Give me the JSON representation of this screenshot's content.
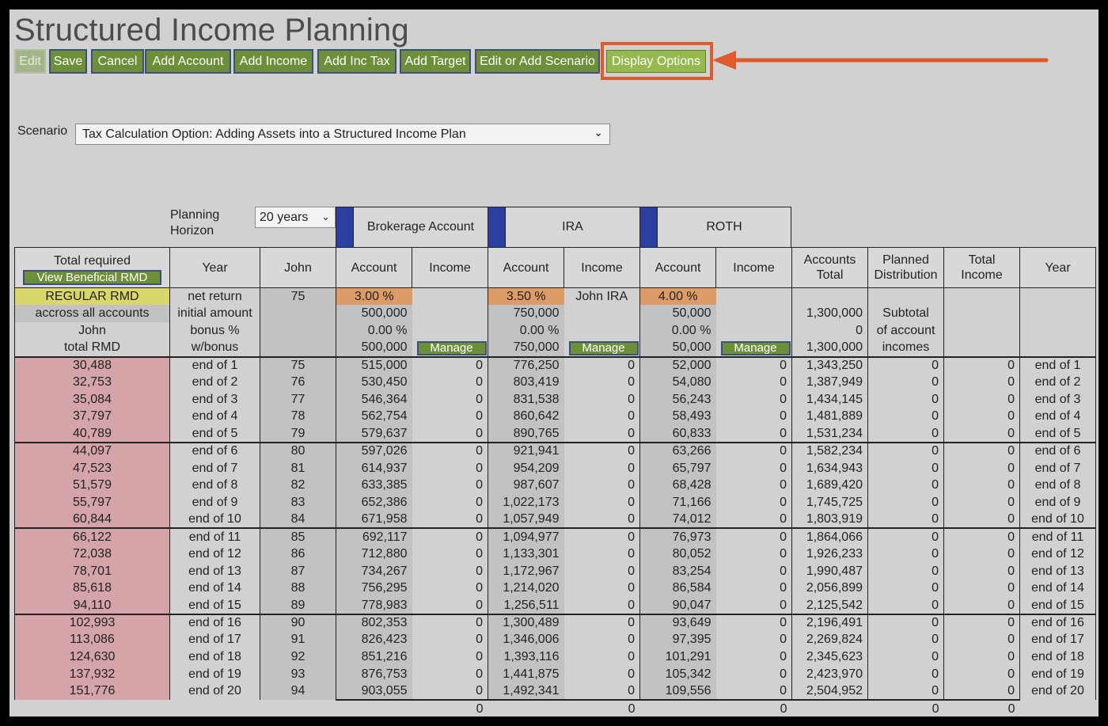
{
  "title": "Structured Income Planning",
  "toolbar": {
    "edit": "Edit",
    "save": "Save",
    "cancel": "Cancel",
    "add_account": "Add Account",
    "add_income": "Add Income",
    "add_inc_tax": "Add Inc Tax",
    "add_target": "Add Target",
    "edit_scenario": "Edit or Add Scenario",
    "display_options": "Display Options"
  },
  "colors": {
    "button": "#6d8f3a",
    "highlight": "#e05a2b",
    "rmd": "#d4a4a9",
    "swatch": "#2b3f9e"
  },
  "scenario": {
    "label": "Scenario",
    "value": "Tax Calculation Option: Adding Assets into a Structured Income Plan"
  },
  "horizon": {
    "label_line1": "Planning",
    "label_line2": "Horizon",
    "value": "20 years"
  },
  "accounts": [
    "Brokerage Account",
    "IRA",
    "ROTH"
  ],
  "headers": {
    "total_required": "Total required",
    "view_rmd": "View Beneficial RMD",
    "year": "Year",
    "john": "John",
    "account": "Account",
    "income": "Income",
    "accounts_total_1": "Accounts",
    "accounts_total_2": "Total",
    "planned_1": "Planned",
    "planned_2": "Distribution",
    "total_income_1": "Total",
    "total_income_2": "Income"
  },
  "info": {
    "regular_rmd": "REGULAR RMD",
    "across": "accross all accounts",
    "john": "John",
    "total_rmd": "total RMD",
    "labels": [
      "net return",
      "initial amount",
      "bonus %",
      "w/bonus"
    ],
    "age": "75",
    "brokerage": {
      "net_return": "3.00  %",
      "initial": "500,000",
      "bonus": "0.00  %",
      "wbonus": "500,000"
    },
    "ira": {
      "net_return": "3.50  %",
      "initial": "750,000",
      "bonus": "0.00  %",
      "wbonus": "750,000",
      "income_label": "John IRA"
    },
    "roth": {
      "net_return": "4.00  %",
      "initial": "50,000",
      "bonus": "0.00  %",
      "wbonus": "50,000"
    },
    "accounts_total": {
      "initial": "1,300,000",
      "bonus": "0",
      "wbonus": "1,300,000"
    },
    "planned": [
      "Subtotal",
      "of account",
      "incomes"
    ],
    "manage": "Manage"
  },
  "rows": [
    {
      "rmd": "30,488",
      "year": "end of 1",
      "age": "75",
      "b": "515,000",
      "i": "776,250",
      "r": "52,000",
      "tot": "1,343,250"
    },
    {
      "rmd": "32,753",
      "year": "end of 2",
      "age": "76",
      "b": "530,450",
      "i": "803,419",
      "r": "54,080",
      "tot": "1,387,949"
    },
    {
      "rmd": "35,084",
      "year": "end of 3",
      "age": "77",
      "b": "546,364",
      "i": "831,538",
      "r": "56,243",
      "tot": "1,434,145"
    },
    {
      "rmd": "37,797",
      "year": "end of 4",
      "age": "78",
      "b": "562,754",
      "i": "860,642",
      "r": "58,493",
      "tot": "1,481,889"
    },
    {
      "rmd": "40,789",
      "year": "end of 5",
      "age": "79",
      "b": "579,637",
      "i": "890,765",
      "r": "60,833",
      "tot": "1,531,234"
    },
    {
      "rmd": "44,097",
      "year": "end of 6",
      "age": "80",
      "b": "597,026",
      "i": "921,941",
      "r": "63,266",
      "tot": "1,582,234"
    },
    {
      "rmd": "47,523",
      "year": "end of 7",
      "age": "81",
      "b": "614,937",
      "i": "954,209",
      "r": "65,797",
      "tot": "1,634,943"
    },
    {
      "rmd": "51,579",
      "year": "end of 8",
      "age": "82",
      "b": "633,385",
      "i": "987,607",
      "r": "68,428",
      "tot": "1,689,420"
    },
    {
      "rmd": "55,797",
      "year": "end of 9",
      "age": "83",
      "b": "652,386",
      "i": "1,022,173",
      "r": "71,166",
      "tot": "1,745,725"
    },
    {
      "rmd": "60,844",
      "year": "end of 10",
      "age": "84",
      "b": "671,958",
      "i": "1,057,949",
      "r": "74,012",
      "tot": "1,803,919"
    },
    {
      "rmd": "66,122",
      "year": "end of 11",
      "age": "85",
      "b": "692,117",
      "i": "1,094,977",
      "r": "76,973",
      "tot": "1,864,066"
    },
    {
      "rmd": "72,038",
      "year": "end of 12",
      "age": "86",
      "b": "712,880",
      "i": "1,133,301",
      "r": "80,052",
      "tot": "1,926,233"
    },
    {
      "rmd": "78,701",
      "year": "end of 13",
      "age": "87",
      "b": "734,267",
      "i": "1,172,967",
      "r": "83,254",
      "tot": "1,990,487"
    },
    {
      "rmd": "85,618",
      "year": "end of 14",
      "age": "88",
      "b": "756,295",
      "i": "1,214,020",
      "r": "86,584",
      "tot": "2,056,899"
    },
    {
      "rmd": "94,110",
      "year": "end of 15",
      "age": "89",
      "b": "778,983",
      "i": "1,256,511",
      "r": "90,047",
      "tot": "2,125,542"
    },
    {
      "rmd": "102,993",
      "year": "end of 16",
      "age": "90",
      "b": "802,353",
      "i": "1,300,489",
      "r": "93,649",
      "tot": "2,196,491"
    },
    {
      "rmd": "113,086",
      "year": "end of 17",
      "age": "91",
      "b": "826,423",
      "i": "1,346,006",
      "r": "97,395",
      "tot": "2,269,824"
    },
    {
      "rmd": "124,630",
      "year": "end of 18",
      "age": "92",
      "b": "851,216",
      "i": "1,393,116",
      "r": "101,291",
      "tot": "2,345,623"
    },
    {
      "rmd": "137,932",
      "year": "end of 19",
      "age": "93",
      "b": "876,753",
      "i": "1,441,875",
      "r": "105,342",
      "tot": "2,423,970"
    },
    {
      "rmd": "151,776",
      "year": "end of 20",
      "age": "94",
      "b": "903,055",
      "i": "1,492,341",
      "r": "109,556",
      "tot": "2,504,952"
    }
  ],
  "zero": "0"
}
